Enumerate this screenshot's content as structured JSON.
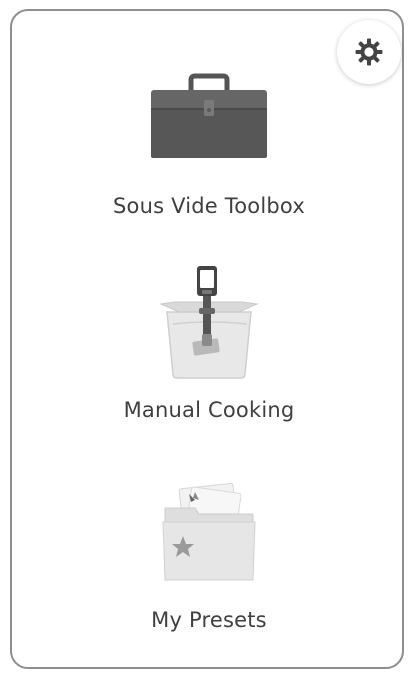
{
  "app": {
    "menu": [
      {
        "id": "toolbox",
        "label": "Sous Vide Toolbox",
        "icon": "toolbox-icon"
      },
      {
        "id": "manual",
        "label": "Manual Cooking",
        "icon": "sous-vide-cooker-icon"
      },
      {
        "id": "presets",
        "label": "My Presets",
        "icon": "folder-star-icon"
      }
    ],
    "settings": {
      "icon": "gear-icon"
    }
  },
  "colors": {
    "frame_border": "#8e8e8e",
    "label_text": "#3f3f3f",
    "toolbox_body": "#555555",
    "icon_light": "#e4e4e4"
  }
}
